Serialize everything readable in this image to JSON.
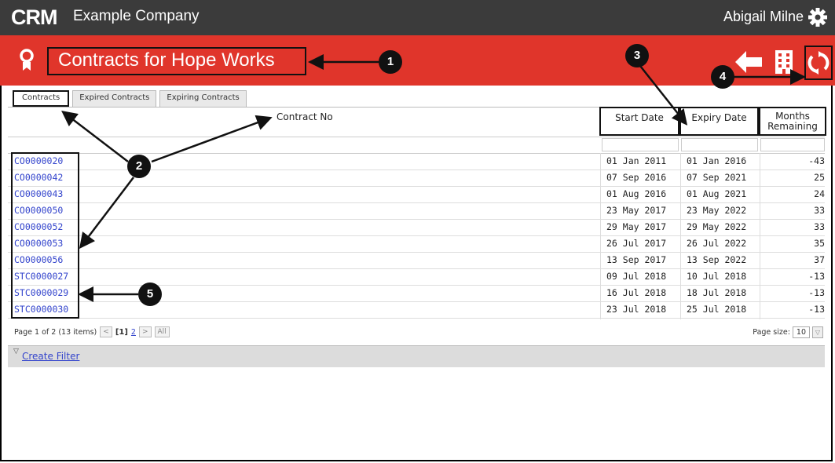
{
  "header": {
    "logo_text": "CRM",
    "company": "Example Company",
    "user": "Abigail Milne",
    "settings_icon": "gear-icon"
  },
  "page": {
    "title": "Contracts for Hope Works",
    "title_icon": "award-ribbon-icon",
    "actions": [
      "back-arrow-icon",
      "building-icon",
      "refresh-icon"
    ]
  },
  "tabs": [
    {
      "label": "Contracts",
      "active": true
    },
    {
      "label": "Expired Contracts",
      "active": false
    },
    {
      "label": "Expiring Contracts",
      "active": false
    }
  ],
  "table": {
    "columns": [
      "Contract No",
      "Start Date",
      "Expiry Date",
      "Months Remaining"
    ],
    "rows": [
      {
        "contract_no": "CO0000020",
        "start": "01 Jan 2011",
        "expiry": "01 Jan 2016",
        "months": "-43"
      },
      {
        "contract_no": "CO0000042",
        "start": "07 Sep 2016",
        "expiry": "07 Sep 2021",
        "months": "25"
      },
      {
        "contract_no": "CO0000043",
        "start": "01 Aug 2016",
        "expiry": "01 Aug 2021",
        "months": "24"
      },
      {
        "contract_no": "CO0000050",
        "start": "23 May 2017",
        "expiry": "23 May 2022",
        "months": "33"
      },
      {
        "contract_no": "CO0000052",
        "start": "29 May 2017",
        "expiry": "29 May 2022",
        "months": "33"
      },
      {
        "contract_no": "CO0000053",
        "start": "26 Jul 2017",
        "expiry": "26 Jul 2022",
        "months": "35"
      },
      {
        "contract_no": "CO0000056",
        "start": "13 Sep 2017",
        "expiry": "13 Sep 2022",
        "months": "37"
      },
      {
        "contract_no": "STC0000027",
        "start": "09 Jul 2018",
        "expiry": "10 Jul 2018",
        "months": "-13"
      },
      {
        "contract_no": "STC0000029",
        "start": "16 Jul 2018",
        "expiry": "18 Jul 2018",
        "months": "-13"
      },
      {
        "contract_no": "STC0000030",
        "start": "23 Jul 2018",
        "expiry": "25 Jul 2018",
        "months": "-13"
      }
    ]
  },
  "pager": {
    "summary": "Page 1 of 2 (13 items)",
    "prev": "<",
    "current": "[1]",
    "page2": "2",
    "next": ">",
    "all": "All",
    "page_size_label": "Page size:",
    "page_size_value": "10"
  },
  "filter": {
    "create_label": "Create Filter"
  },
  "callouts": [
    "1",
    "2",
    "3",
    "4",
    "5"
  ],
  "colors": {
    "topbar": "#3b3b3b",
    "accent_red": "#e0352b",
    "link_blue": "#3344cc"
  }
}
